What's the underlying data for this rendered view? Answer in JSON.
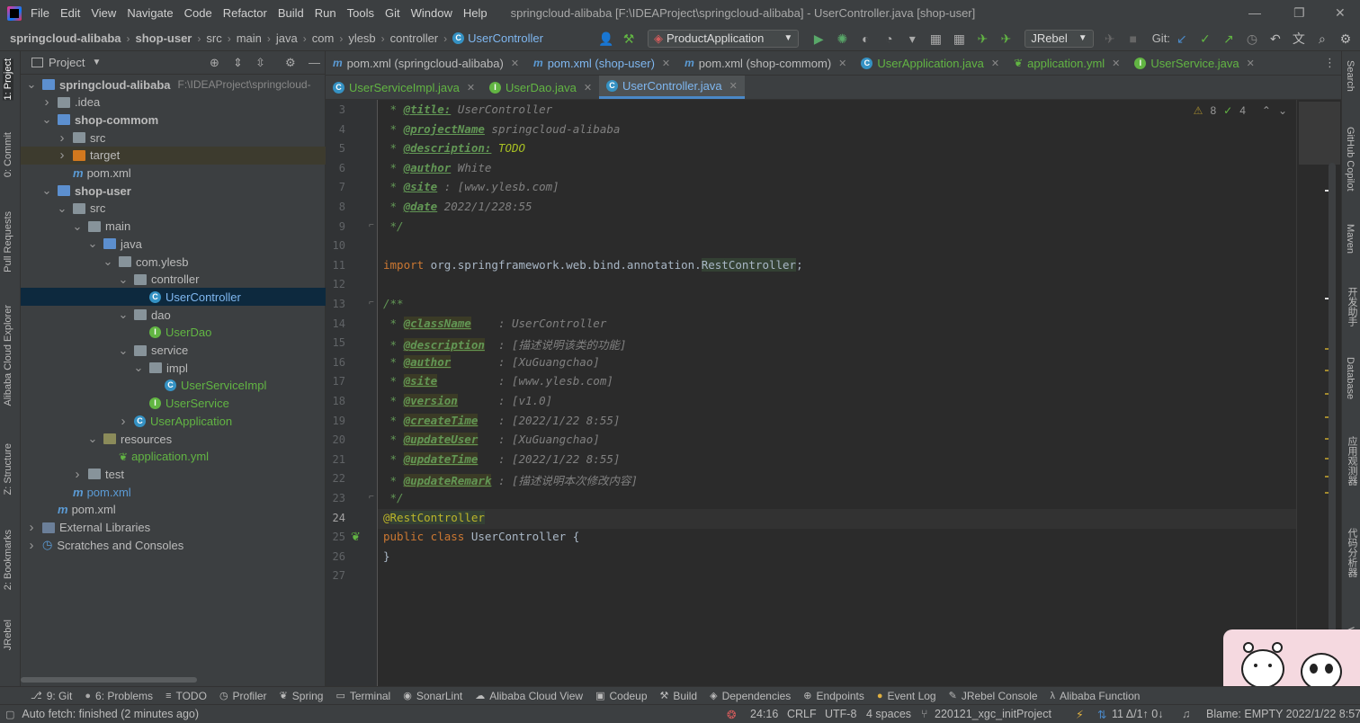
{
  "titlebar": {
    "menu": [
      "File",
      "Edit",
      "View",
      "Navigate",
      "Code",
      "Refactor",
      "Build",
      "Run",
      "Tools",
      "Git",
      "Window",
      "Help"
    ],
    "window_title": "springcloud-alibaba [F:\\IDEAProject\\springcloud-alibaba] - UserController.java [shop-user]"
  },
  "navbar": {
    "breadcrumb": [
      "springcloud-alibaba",
      "shop-user",
      "src",
      "main",
      "java",
      "com",
      "ylesb",
      "controller",
      "UserController"
    ],
    "run_config": "ProductApplication",
    "jrebel": "JRebel",
    "git_label": "Git:"
  },
  "left_tool_tabs": [
    "1: Project",
    "0: Commit",
    "Pull Requests",
    "Alibaba Cloud Explorer",
    "Z: Structure",
    "2: Bookmarks",
    "JRebel"
  ],
  "right_tool_tabs": [
    "Search",
    "GitHub Copilot",
    "Maven",
    "开发助手",
    "Database",
    "应用观测器",
    "代码分析器",
    "Vis"
  ],
  "project_panel": {
    "title": "Project",
    "tree": [
      {
        "label": "springcloud-alibaba",
        "extra": "F:\\IDEAProject\\springcloud-",
        "kind": "module",
        "bold": true,
        "depth": 0,
        "open": true
      },
      {
        "label": ".idea",
        "kind": "folder",
        "depth": 1,
        "open": false
      },
      {
        "label": "shop-commom",
        "kind": "module",
        "bold": true,
        "depth": 1,
        "open": true
      },
      {
        "label": "src",
        "kind": "folder",
        "depth": 2,
        "open": false
      },
      {
        "label": "target",
        "kind": "folder-orange",
        "depth": 2,
        "open": false,
        "highlight": true
      },
      {
        "label": "pom.xml",
        "kind": "maven",
        "depth": 2
      },
      {
        "label": "shop-user",
        "kind": "module",
        "bold": true,
        "depth": 1,
        "open": true
      },
      {
        "label": "src",
        "kind": "folder",
        "depth": 2,
        "open": true
      },
      {
        "label": "main",
        "kind": "folder",
        "depth": 3,
        "open": true
      },
      {
        "label": "java",
        "kind": "folder-blue",
        "depth": 4,
        "open": true
      },
      {
        "label": "com.ylesb",
        "kind": "folder",
        "depth": 5,
        "open": true
      },
      {
        "label": "controller",
        "kind": "folder",
        "depth": 6,
        "open": true
      },
      {
        "label": "UserController",
        "kind": "class",
        "depth": 7,
        "selected": true
      },
      {
        "label": "dao",
        "kind": "folder",
        "depth": 6,
        "open": true
      },
      {
        "label": "UserDao",
        "kind": "iface",
        "depth": 7
      },
      {
        "label": "service",
        "kind": "folder",
        "depth": 6,
        "open": true
      },
      {
        "label": "impl",
        "kind": "folder",
        "depth": 7,
        "open": true
      },
      {
        "label": "UserServiceImpl",
        "kind": "class",
        "depth": 8
      },
      {
        "label": "UserService",
        "kind": "iface",
        "depth": 7
      },
      {
        "label": "UserApplication",
        "kind": "class",
        "depth": 6,
        "open": false
      },
      {
        "label": "resources",
        "kind": "folder-res",
        "depth": 4,
        "open": true
      },
      {
        "label": "application.yml",
        "kind": "yml",
        "depth": 5
      },
      {
        "label": "test",
        "kind": "folder",
        "depth": 3,
        "open": false
      },
      {
        "label": "pom.xml",
        "kind": "maven",
        "depth": 2
      },
      {
        "label": "pom.xml",
        "kind": "maven",
        "depth": 1
      },
      {
        "label": "External Libraries",
        "kind": "lib",
        "depth": 0,
        "open": false
      },
      {
        "label": "Scratches and Consoles",
        "kind": "scratch",
        "depth": 0,
        "open": false
      }
    ]
  },
  "editor_tabs_row1": [
    {
      "label": "pom.xml (springcloud-alibaba)",
      "icon": "m"
    },
    {
      "label": "pom.xml (shop-user)",
      "icon": "m",
      "color": "blue"
    },
    {
      "label": "pom.xml (shop-commom)",
      "icon": "m"
    },
    {
      "label": "UserApplication.java",
      "icon": "c",
      "color": "green"
    },
    {
      "label": "application.yml",
      "icon": "y",
      "color": "green"
    },
    {
      "label": "UserService.java",
      "icon": "i",
      "color": "green"
    }
  ],
  "editor_tabs_row2": [
    {
      "label": "UserServiceImpl.java",
      "icon": "c",
      "color": "green"
    },
    {
      "label": "UserDao.java",
      "icon": "i",
      "color": "green"
    },
    {
      "label": "UserController.java",
      "icon": "c",
      "active": true
    }
  ],
  "inspections": {
    "warnings": "8",
    "weak": "4"
  },
  "code_lines": [
    {
      "n": "3",
      "html": " * <span class='tag'>@title:</span><span class='c-gray'> UserController</span>"
    },
    {
      "n": "4",
      "html": " * <span class='tag'>@projectName</span><span class='c-gray'> springcloud-alibaba</span>"
    },
    {
      "n": "5",
      "html": " * <span class='tag'>@description:</span><span class='todo'> TODO</span>"
    },
    {
      "n": "6",
      "html": " * <span class='tag'>@author</span><span class='c-gray'> White</span>"
    },
    {
      "n": "7",
      "html": " * <span class='tag'>@site</span><span class='c-gray'> : [www.ylesb.com]</span>"
    },
    {
      "n": "8",
      "html": " * <span class='tag'>@date</span><span class='c-gray'> 2022/1/228:55</span>"
    },
    {
      "n": "9",
      "html": " */"
    },
    {
      "n": "10",
      "html": ""
    },
    {
      "n": "11",
      "html": "<span class='kw'>import</span> org.springframework.web.bind.annotation.<span class='hl-ref'>RestController</span>;"
    },
    {
      "n": "12",
      "html": ""
    },
    {
      "n": "13",
      "html": "/**"
    },
    {
      "n": "14",
      "html": " * <span class='tagbg'>@className</span><span class='c-gray'>    : UserController</span>"
    },
    {
      "n": "15",
      "html": " * <span class='tagbg'>@description</span><span class='c-gray'>  : [描述说明该类的功能]</span>"
    },
    {
      "n": "16",
      "html": " * <span class='tagbg'>@author</span><span class='c-gray'>       : [XuGuangchao]</span>"
    },
    {
      "n": "17",
      "html": " * <span class='tagbg'>@site</span><span class='c-gray'>         : [www.ylesb.com]</span>"
    },
    {
      "n": "18",
      "html": " * <span class='tagbg'>@version</span><span class='c-gray'>      : [v1.0]</span>"
    },
    {
      "n": "19",
      "html": " * <span class='tagbg'>@createTime</span><span class='c-gray'>   : [2022/1/22 8:55]</span>"
    },
    {
      "n": "20",
      "html": " * <span class='tagbg'>@updateUser</span><span class='c-gray'>   : [XuGuangchao]</span>"
    },
    {
      "n": "21",
      "html": " * <span class='tagbg'>@updateTime</span><span class='c-gray'>   : [2022/1/22 8:55]</span>"
    },
    {
      "n": "22",
      "html": " * <span class='tagbg'>@updateRemark</span><span class='c-gray'> : [描述说明本次修改内容]</span>"
    },
    {
      "n": "23",
      "html": " */"
    },
    {
      "n": "24",
      "html": "<span class='ann'>@<span class='hl-ref'>RestController</span></span>",
      "current": true
    },
    {
      "n": "25",
      "html": "<span class='kw'>public class</span> UserController {"
    },
    {
      "n": "26",
      "html": "}"
    },
    {
      "n": "27",
      "html": ""
    }
  ],
  "bottom_tools": [
    {
      "icon": "⎇",
      "label": "9: Git"
    },
    {
      "icon": "●",
      "label": "6: Problems"
    },
    {
      "icon": "≡",
      "label": "TODO"
    },
    {
      "icon": "◷",
      "label": "Profiler"
    },
    {
      "icon": "❦",
      "label": "Spring"
    },
    {
      "icon": "▭",
      "label": "Terminal"
    },
    {
      "icon": "◉",
      "label": "SonarLint"
    },
    {
      "icon": "☁",
      "label": "Alibaba Cloud View"
    },
    {
      "icon": "▣",
      "label": "Codeup"
    },
    {
      "icon": "⚒",
      "label": "Build"
    },
    {
      "icon": "◈",
      "label": "Dependencies"
    },
    {
      "icon": "⊕",
      "label": "Endpoints"
    },
    {
      "icon": "●",
      "label": "Event Log"
    },
    {
      "icon": "✎",
      "label": "JRebel Console"
    },
    {
      "icon": "λ",
      "label": "Alibaba Function"
    }
  ],
  "statusbar": {
    "left": "Auto fetch: finished (2 minutes ago)",
    "position": "24:16",
    "line_sep": "CRLF",
    "encoding": "UTF-8",
    "indent": "4 spaces",
    "branch": "220121_xgc_initProject",
    "git_counts": "11 Δ/1↑ 0↓",
    "blame": "Blame: EMPTY 2022/1/22 8:57"
  },
  "colors": {
    "accent": "#4a88c7",
    "selection": "#0d293e",
    "panel": "#3c3f41",
    "editor": "#2b2b2b"
  }
}
